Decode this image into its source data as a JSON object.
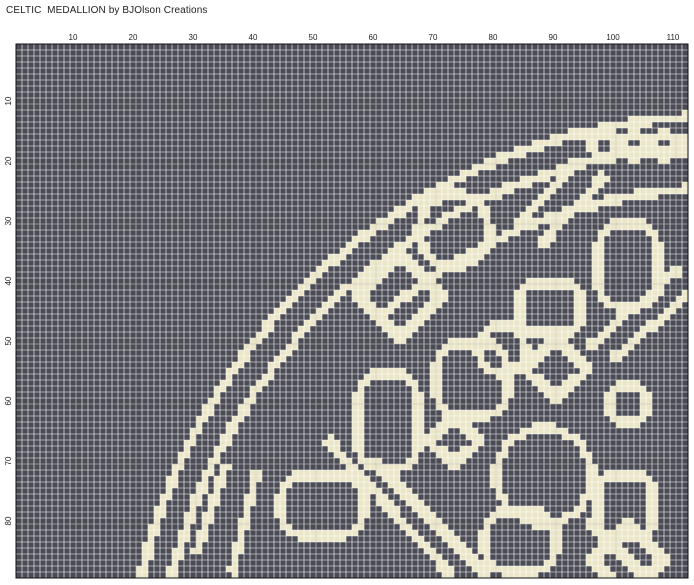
{
  "title": "CELTIC  MEDALLION by BJOlson Creations",
  "grid": {
    "columns_visible": 112,
    "rows_visible": 89,
    "x_tick_labels": [
      "10",
      "20",
      "30",
      "40",
      "50",
      "60",
      "70",
      "80",
      "90",
      "100",
      "110"
    ],
    "y_tick_labels": [
      "10",
      "20",
      "30",
      "40",
      "50",
      "60",
      "70",
      "80"
    ]
  },
  "colors": {
    "filled_cell": "#4b4b55",
    "open_cell": "#ebe6c8",
    "grid_line": "#ffffff",
    "bold_grid_line": "#111111",
    "border": "#111111"
  }
}
